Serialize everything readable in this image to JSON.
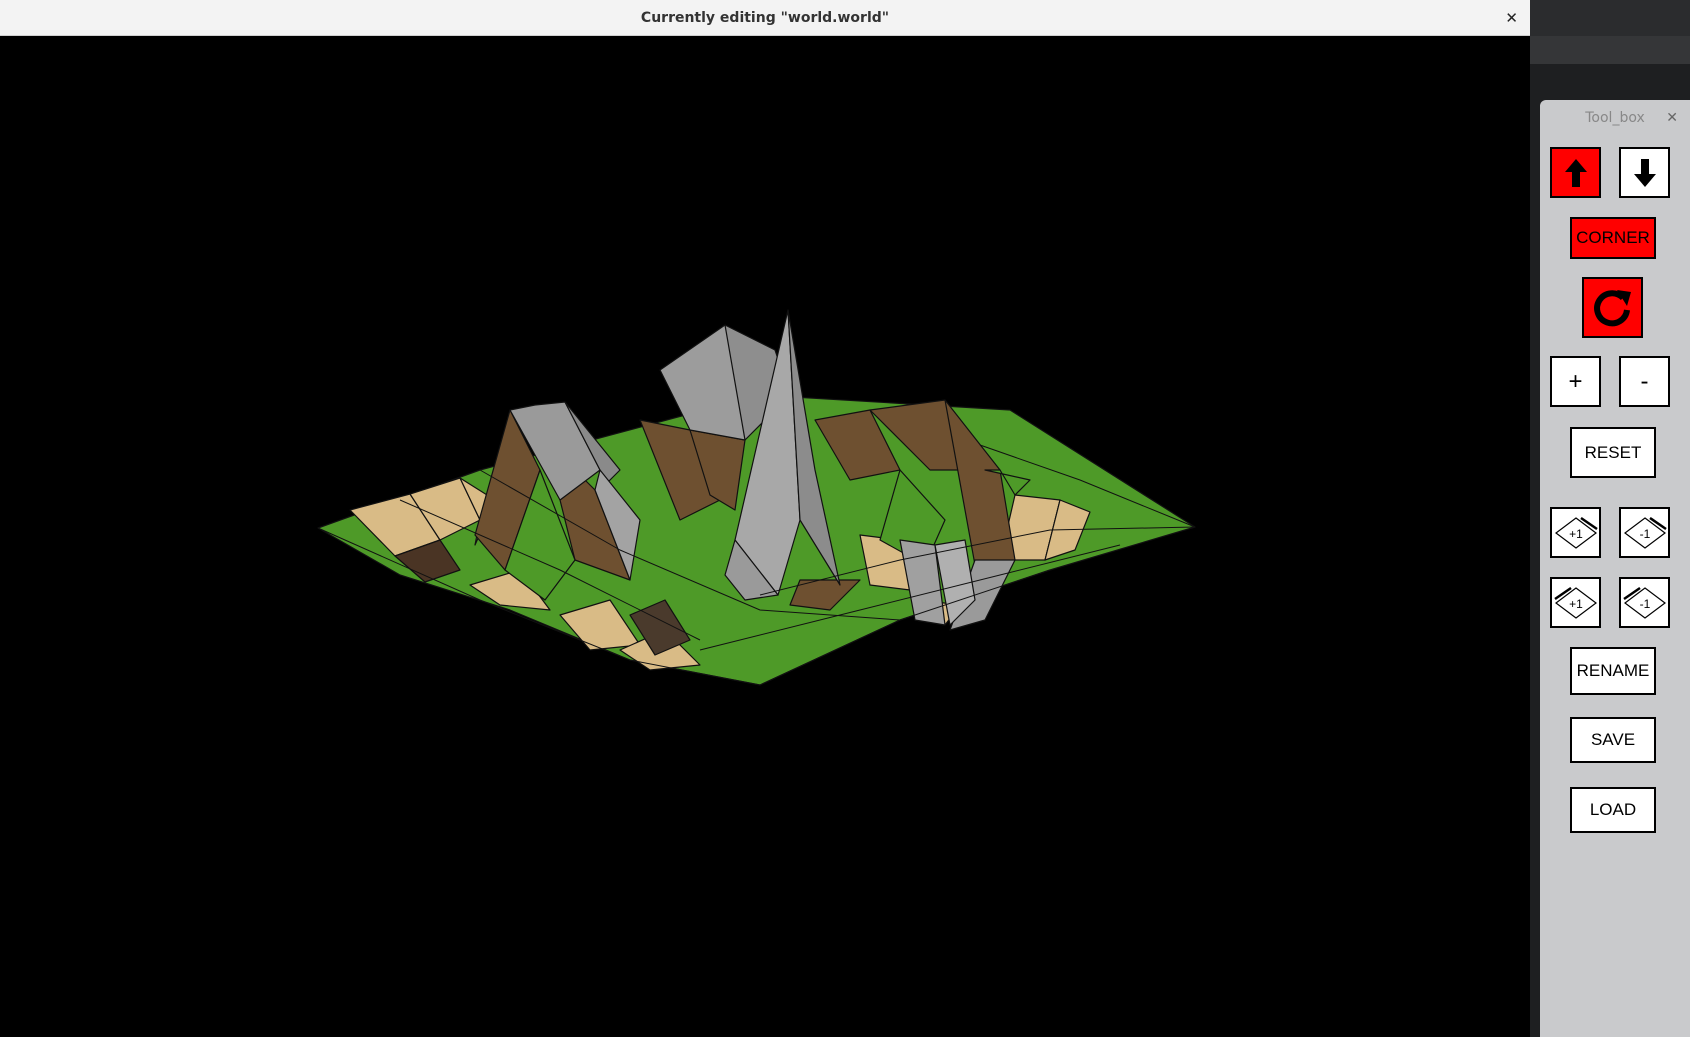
{
  "window": {
    "title": "Currently editing \"world.world\"",
    "close_glyph": "✕"
  },
  "toolbox": {
    "title": "Tool_box",
    "close_glyph": "✕",
    "buttons": {
      "raise_icon": "arrow-up-icon",
      "lower_icon": "arrow-down-icon",
      "corner": "CORNER",
      "rotate_icon": "rotate-clockwise-icon",
      "zoom_in": "+",
      "zoom_out": "-",
      "reset": "RESET",
      "edge_plus_right": "+1",
      "edge_minus_right": "-1",
      "edge_plus_left": "+1",
      "edge_minus_left": "-1",
      "rename": "RENAME",
      "save": "SAVE",
      "load": "LOAD"
    }
  },
  "colors": {
    "active_button": "#ff0000",
    "grass": "#4e9a28",
    "sand": "#d9bb86",
    "dirt": "#6e5030",
    "rock": "#9a9a9a"
  }
}
